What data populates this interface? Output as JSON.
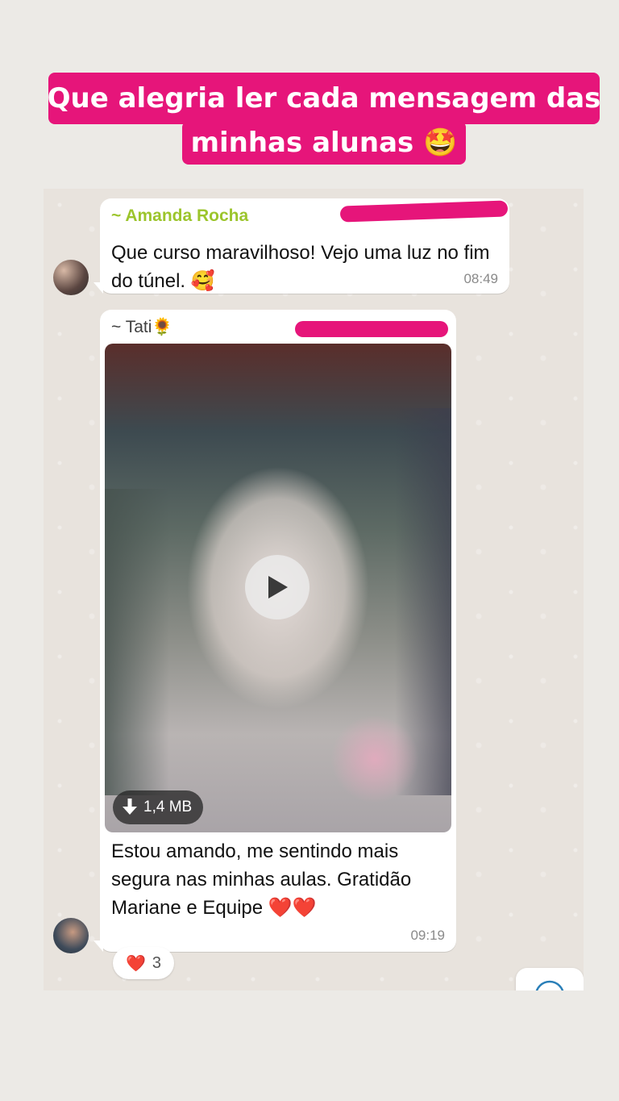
{
  "caption": {
    "line1": "Que alegria ler cada mensagem das",
    "line2": "minhas alunas 🤩"
  },
  "messages": [
    {
      "sender": "~ Amanda Rocha",
      "text": "Que curso maravilhoso! Vejo uma luz no fim do túnel. 🥰",
      "time": "08:49"
    },
    {
      "sender": "~ Tati🌻",
      "video": {
        "size": "1,4 MB"
      },
      "text": "Estou amando, me sentindo mais segura nas minhas aulas. Gratidão Mariane e Equipe ❤️❤️",
      "time": "09:19",
      "reaction": {
        "emoji": "❤️",
        "count": "3"
      }
    }
  ],
  "colors": {
    "caption_bg": "#e6157a",
    "sender_amanda": "#9cc52c",
    "chat_bg": "#e8e3dd"
  }
}
